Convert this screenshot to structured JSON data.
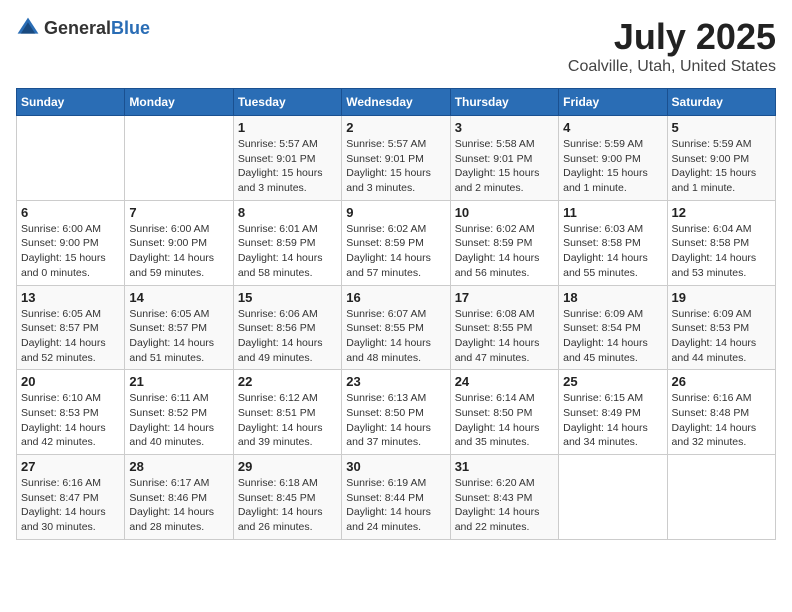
{
  "header": {
    "logo_general": "General",
    "logo_blue": "Blue",
    "month": "July 2025",
    "location": "Coalville, Utah, United States"
  },
  "weekdays": [
    "Sunday",
    "Monday",
    "Tuesday",
    "Wednesday",
    "Thursday",
    "Friday",
    "Saturday"
  ],
  "weeks": [
    [
      {
        "date": "",
        "sunrise": "",
        "sunset": "",
        "daylight": ""
      },
      {
        "date": "",
        "sunrise": "",
        "sunset": "",
        "daylight": ""
      },
      {
        "date": "1",
        "sunrise": "Sunrise: 5:57 AM",
        "sunset": "Sunset: 9:01 PM",
        "daylight": "Daylight: 15 hours and 3 minutes."
      },
      {
        "date": "2",
        "sunrise": "Sunrise: 5:57 AM",
        "sunset": "Sunset: 9:01 PM",
        "daylight": "Daylight: 15 hours and 3 minutes."
      },
      {
        "date": "3",
        "sunrise": "Sunrise: 5:58 AM",
        "sunset": "Sunset: 9:01 PM",
        "daylight": "Daylight: 15 hours and 2 minutes."
      },
      {
        "date": "4",
        "sunrise": "Sunrise: 5:59 AM",
        "sunset": "Sunset: 9:00 PM",
        "daylight": "Daylight: 15 hours and 1 minute."
      },
      {
        "date": "5",
        "sunrise": "Sunrise: 5:59 AM",
        "sunset": "Sunset: 9:00 PM",
        "daylight": "Daylight: 15 hours and 1 minute."
      }
    ],
    [
      {
        "date": "6",
        "sunrise": "Sunrise: 6:00 AM",
        "sunset": "Sunset: 9:00 PM",
        "daylight": "Daylight: 15 hours and 0 minutes."
      },
      {
        "date": "7",
        "sunrise": "Sunrise: 6:00 AM",
        "sunset": "Sunset: 9:00 PM",
        "daylight": "Daylight: 14 hours and 59 minutes."
      },
      {
        "date": "8",
        "sunrise": "Sunrise: 6:01 AM",
        "sunset": "Sunset: 8:59 PM",
        "daylight": "Daylight: 14 hours and 58 minutes."
      },
      {
        "date": "9",
        "sunrise": "Sunrise: 6:02 AM",
        "sunset": "Sunset: 8:59 PM",
        "daylight": "Daylight: 14 hours and 57 minutes."
      },
      {
        "date": "10",
        "sunrise": "Sunrise: 6:02 AM",
        "sunset": "Sunset: 8:59 PM",
        "daylight": "Daylight: 14 hours and 56 minutes."
      },
      {
        "date": "11",
        "sunrise": "Sunrise: 6:03 AM",
        "sunset": "Sunset: 8:58 PM",
        "daylight": "Daylight: 14 hours and 55 minutes."
      },
      {
        "date": "12",
        "sunrise": "Sunrise: 6:04 AM",
        "sunset": "Sunset: 8:58 PM",
        "daylight": "Daylight: 14 hours and 53 minutes."
      }
    ],
    [
      {
        "date": "13",
        "sunrise": "Sunrise: 6:05 AM",
        "sunset": "Sunset: 8:57 PM",
        "daylight": "Daylight: 14 hours and 52 minutes."
      },
      {
        "date": "14",
        "sunrise": "Sunrise: 6:05 AM",
        "sunset": "Sunset: 8:57 PM",
        "daylight": "Daylight: 14 hours and 51 minutes."
      },
      {
        "date": "15",
        "sunrise": "Sunrise: 6:06 AM",
        "sunset": "Sunset: 8:56 PM",
        "daylight": "Daylight: 14 hours and 49 minutes."
      },
      {
        "date": "16",
        "sunrise": "Sunrise: 6:07 AM",
        "sunset": "Sunset: 8:55 PM",
        "daylight": "Daylight: 14 hours and 48 minutes."
      },
      {
        "date": "17",
        "sunrise": "Sunrise: 6:08 AM",
        "sunset": "Sunset: 8:55 PM",
        "daylight": "Daylight: 14 hours and 47 minutes."
      },
      {
        "date": "18",
        "sunrise": "Sunrise: 6:09 AM",
        "sunset": "Sunset: 8:54 PM",
        "daylight": "Daylight: 14 hours and 45 minutes."
      },
      {
        "date": "19",
        "sunrise": "Sunrise: 6:09 AM",
        "sunset": "Sunset: 8:53 PM",
        "daylight": "Daylight: 14 hours and 44 minutes."
      }
    ],
    [
      {
        "date": "20",
        "sunrise": "Sunrise: 6:10 AM",
        "sunset": "Sunset: 8:53 PM",
        "daylight": "Daylight: 14 hours and 42 minutes."
      },
      {
        "date": "21",
        "sunrise": "Sunrise: 6:11 AM",
        "sunset": "Sunset: 8:52 PM",
        "daylight": "Daylight: 14 hours and 40 minutes."
      },
      {
        "date": "22",
        "sunrise": "Sunrise: 6:12 AM",
        "sunset": "Sunset: 8:51 PM",
        "daylight": "Daylight: 14 hours and 39 minutes."
      },
      {
        "date": "23",
        "sunrise": "Sunrise: 6:13 AM",
        "sunset": "Sunset: 8:50 PM",
        "daylight": "Daylight: 14 hours and 37 minutes."
      },
      {
        "date": "24",
        "sunrise": "Sunrise: 6:14 AM",
        "sunset": "Sunset: 8:50 PM",
        "daylight": "Daylight: 14 hours and 35 minutes."
      },
      {
        "date": "25",
        "sunrise": "Sunrise: 6:15 AM",
        "sunset": "Sunset: 8:49 PM",
        "daylight": "Daylight: 14 hours and 34 minutes."
      },
      {
        "date": "26",
        "sunrise": "Sunrise: 6:16 AM",
        "sunset": "Sunset: 8:48 PM",
        "daylight": "Daylight: 14 hours and 32 minutes."
      }
    ],
    [
      {
        "date": "27",
        "sunrise": "Sunrise: 6:16 AM",
        "sunset": "Sunset: 8:47 PM",
        "daylight": "Daylight: 14 hours and 30 minutes."
      },
      {
        "date": "28",
        "sunrise": "Sunrise: 6:17 AM",
        "sunset": "Sunset: 8:46 PM",
        "daylight": "Daylight: 14 hours and 28 minutes."
      },
      {
        "date": "29",
        "sunrise": "Sunrise: 6:18 AM",
        "sunset": "Sunset: 8:45 PM",
        "daylight": "Daylight: 14 hours and 26 minutes."
      },
      {
        "date": "30",
        "sunrise": "Sunrise: 6:19 AM",
        "sunset": "Sunset: 8:44 PM",
        "daylight": "Daylight: 14 hours and 24 minutes."
      },
      {
        "date": "31",
        "sunrise": "Sunrise: 6:20 AM",
        "sunset": "Sunset: 8:43 PM",
        "daylight": "Daylight: 14 hours and 22 minutes."
      },
      {
        "date": "",
        "sunrise": "",
        "sunset": "",
        "daylight": ""
      },
      {
        "date": "",
        "sunrise": "",
        "sunset": "",
        "daylight": ""
      }
    ]
  ]
}
